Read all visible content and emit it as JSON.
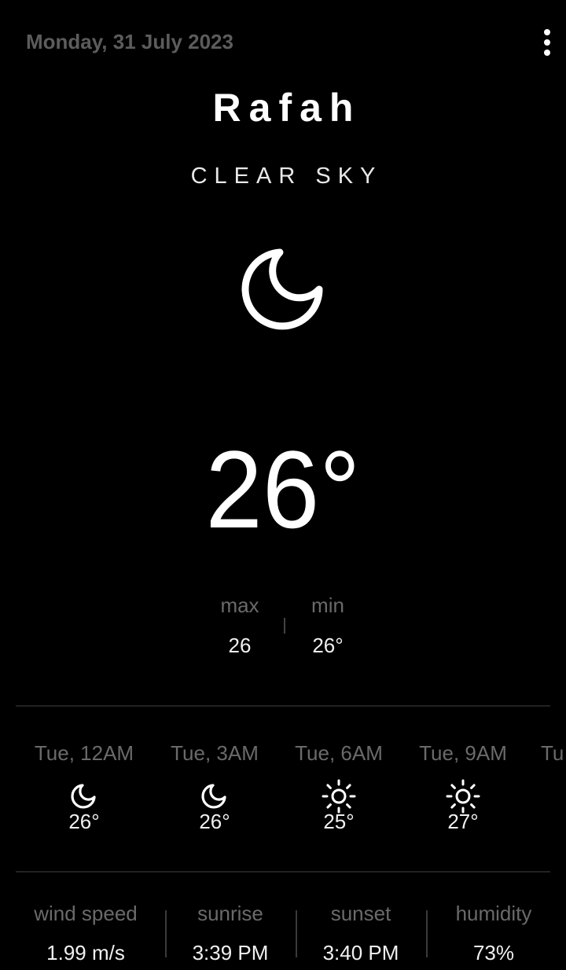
{
  "header": {
    "date": "Monday, 31 July 2023",
    "menu_icon": "more-vertical-icon"
  },
  "current": {
    "city": "Rafah",
    "condition": "CLEAR SKY",
    "icon": "moon-icon",
    "temperature": "26°",
    "max_label": "max",
    "max_value": "26",
    "min_label": "min",
    "min_value": "26°"
  },
  "forecast": [
    {
      "time": "Tue, 12AM",
      "icon": "moon-icon",
      "temp": "26°"
    },
    {
      "time": "Tue, 3AM",
      "icon": "moon-icon",
      "temp": "26°"
    },
    {
      "time": "Tue, 6AM",
      "icon": "sun-icon",
      "temp": "25°"
    },
    {
      "time": "Tue, 9AM",
      "icon": "sun-icon",
      "temp": "27°"
    },
    {
      "time": "Tu",
      "icon": "",
      "temp": ""
    }
  ],
  "details": [
    {
      "label": "wind speed",
      "value": "1.99 m/s"
    },
    {
      "label": "sunrise",
      "value": "3:39 PM"
    },
    {
      "label": "sunset",
      "value": "3:40 PM"
    },
    {
      "label": "humidity",
      "value": "73%"
    }
  ],
  "colors": {
    "background": "#000000",
    "primary_text": "#ffffff",
    "secondary_text": "#6a6a6a",
    "divider": "#222222"
  }
}
